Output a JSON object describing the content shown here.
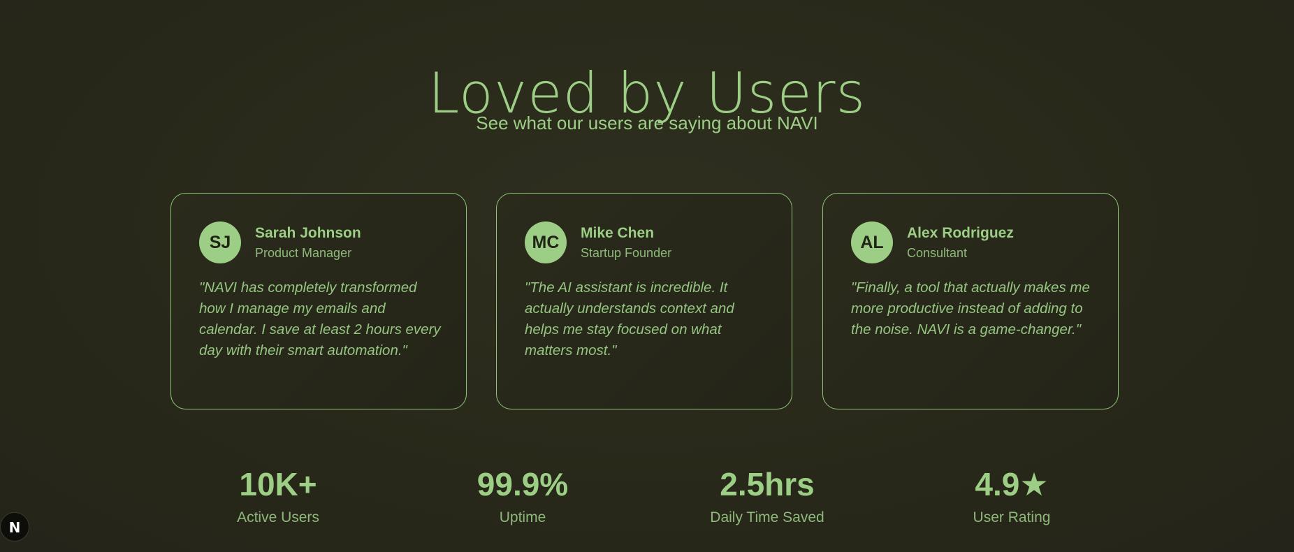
{
  "header": {
    "title": "Loved by Users",
    "subtitle": "See what our users are saying about NAVI"
  },
  "testimonials": [
    {
      "initials": "SJ",
      "name": "Sarah Johnson",
      "role": "Product Manager",
      "quote": "\"NAVI has completely transformed how I manage my emails and calendar. I save at least 2 hours every day with their smart automation.\""
    },
    {
      "initials": "MC",
      "name": "Mike Chen",
      "role": "Startup Founder",
      "quote": "\"The AI assistant is incredible. It actually understands context and helps me stay focused on what matters most.\""
    },
    {
      "initials": "AL",
      "name": "Alex Rodriguez",
      "role": "Consultant",
      "quote": "\"Finally, a tool that actually makes me more productive instead of adding to the noise. NAVI is a game-changer.\""
    }
  ],
  "stats": [
    {
      "value": "10K+",
      "label": "Active Users"
    },
    {
      "value": "99.9%",
      "label": "Uptime"
    },
    {
      "value": "2.5hrs",
      "label": "Daily Time Saved"
    },
    {
      "value": "4.9★",
      "label": "User Rating"
    }
  ],
  "badge": {
    "letter": "N",
    "icon": "nextjs-icon"
  },
  "colors": {
    "background": "#2a2a1c",
    "accent": "#9ccf85",
    "avatar_text": "#232418"
  }
}
